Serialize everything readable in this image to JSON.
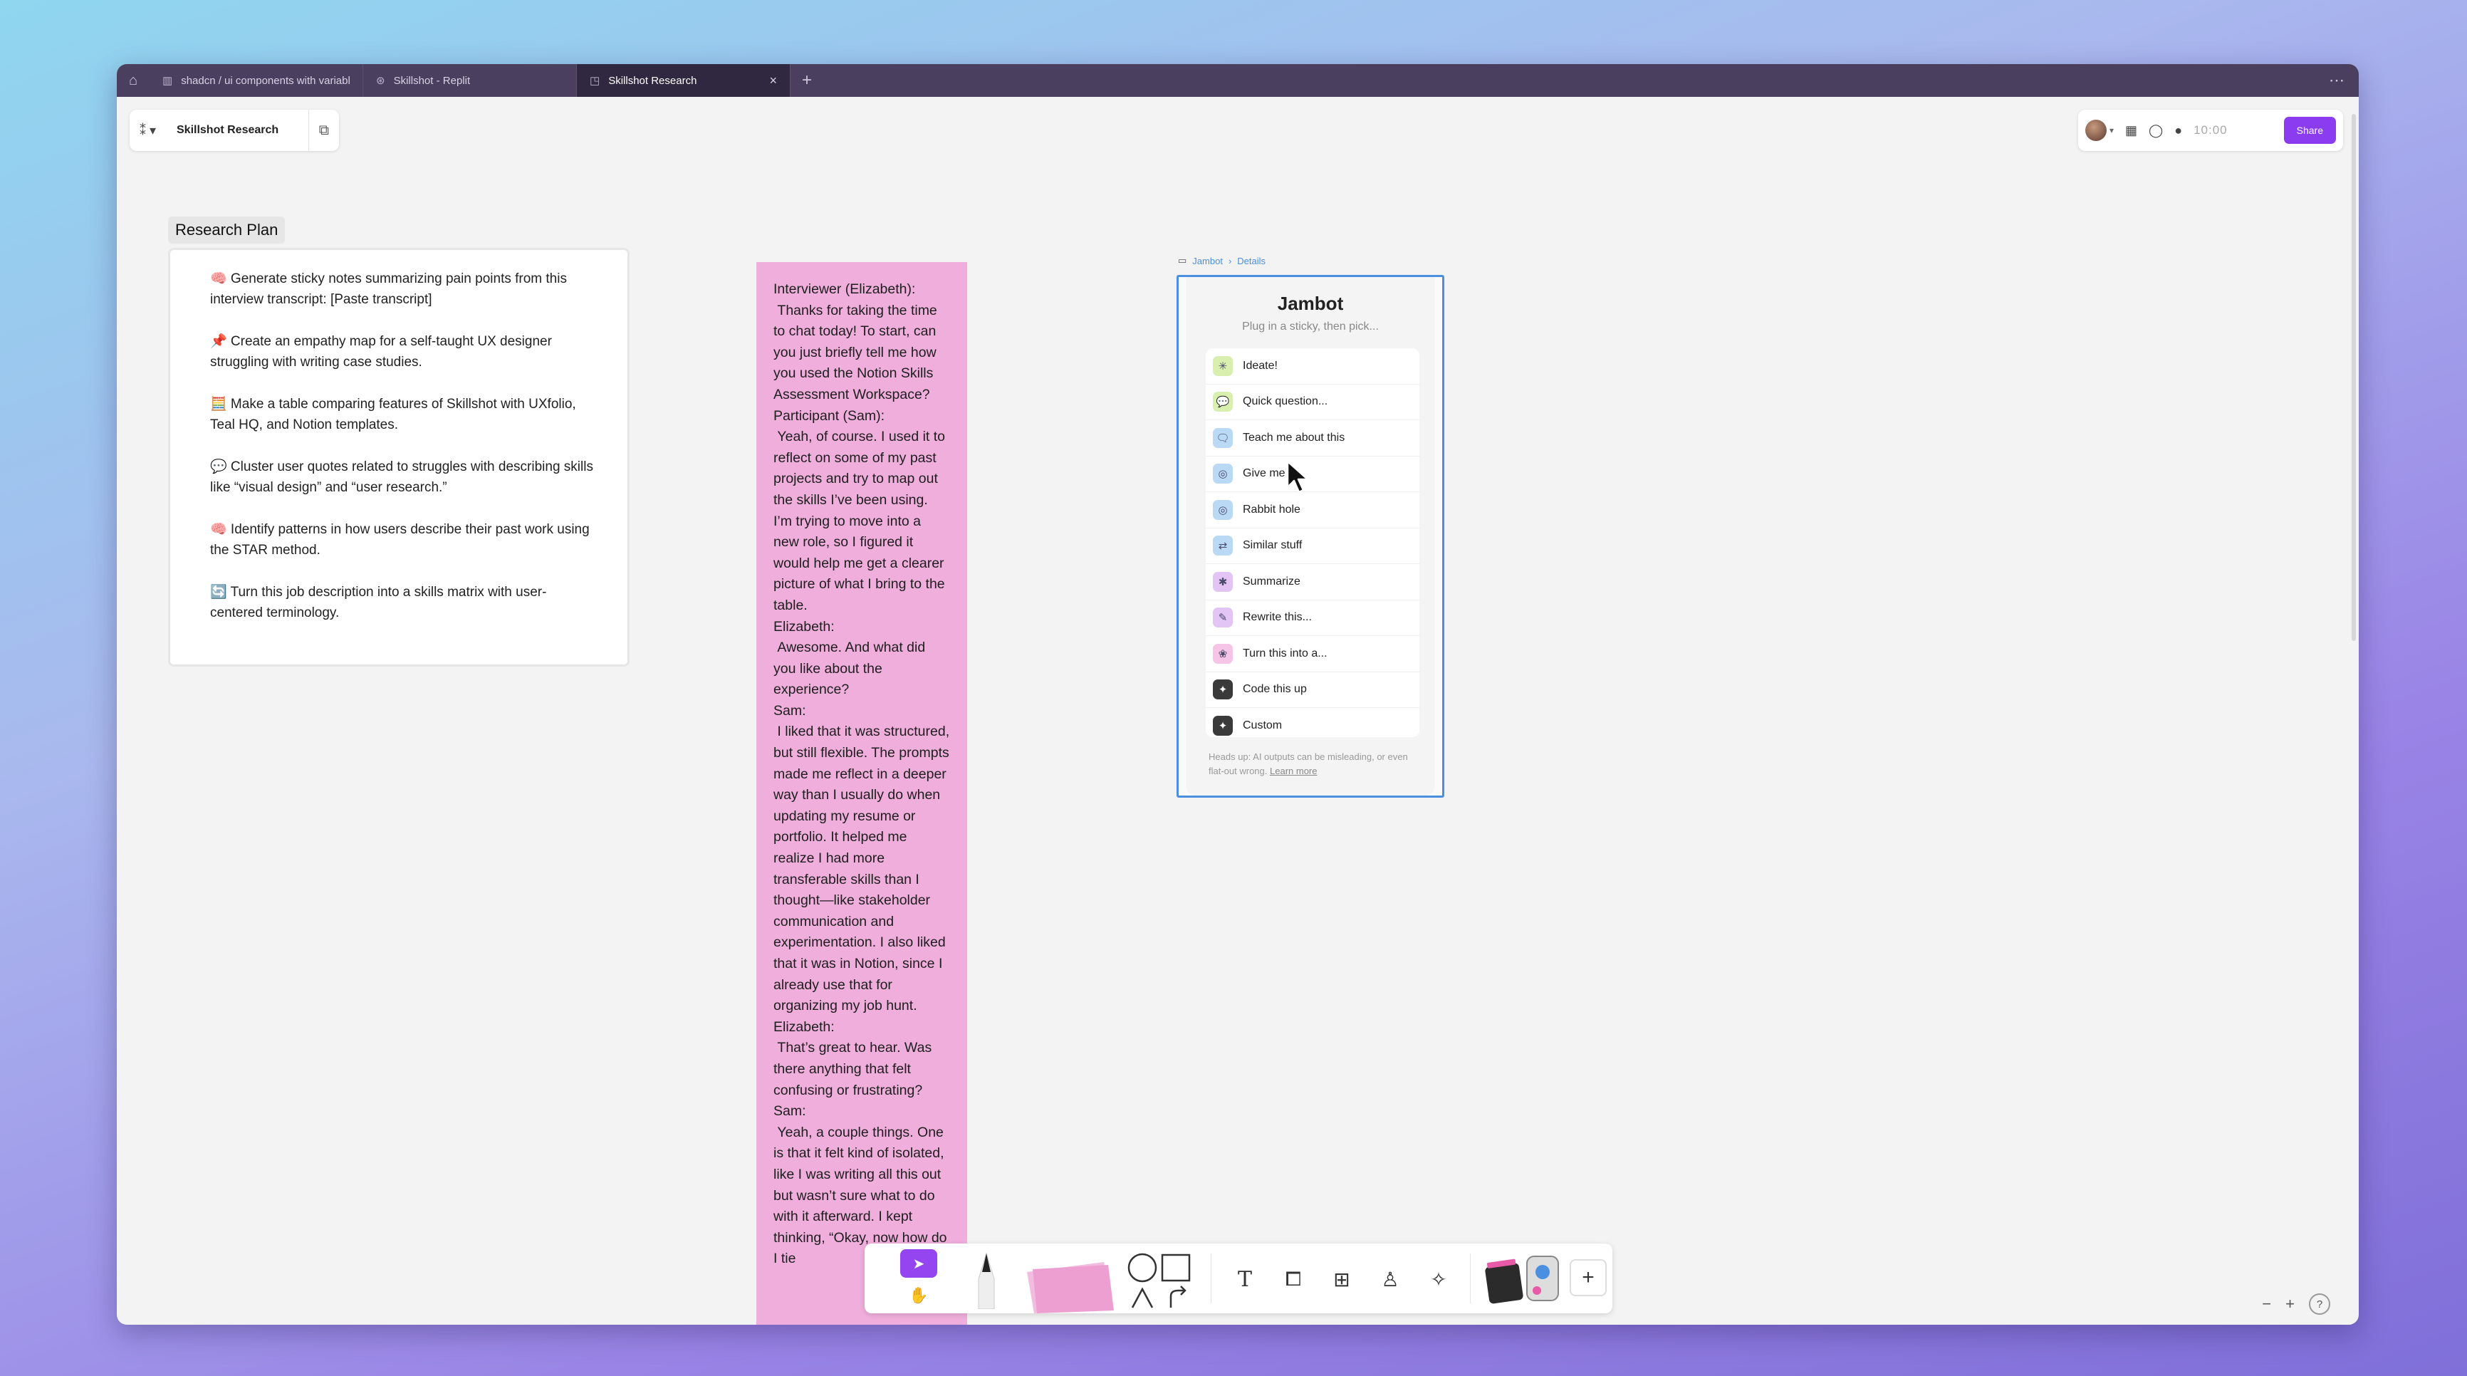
{
  "browser": {
    "tabs": [
      {
        "label": "shadcn / ui components with variable"
      },
      {
        "label": "Skillshot - Replit"
      },
      {
        "label": "Skillshot Research"
      }
    ],
    "home_icon": "home-icon",
    "new_tab": "+",
    "more": "⋯"
  },
  "board": {
    "title": "Skillshot Research",
    "timer": "10:00",
    "share_label": "Share"
  },
  "research_plan": {
    "label": "Research Plan",
    "items": [
      "🧠 Generate sticky notes summarizing pain points from this interview transcript: [Paste transcript]",
      "📌 Create an empathy map for a self-taught UX designer struggling with writing case studies.",
      "🧮 Make a table comparing features of Skillshot with UXfolio, Teal HQ, and Notion templates.",
      "💬 Cluster user quotes related to struggles with describing skills like “visual design” and “user research.”",
      "🧠 Identify patterns in how users describe their past work using the STAR method.",
      "🔄 Turn this job description into a skills matrix with user-centered terminology."
    ]
  },
  "sticky": {
    "text": "Interviewer (Elizabeth):\n Thanks for taking the time to chat today! To start, can you just briefly tell me how you used the Notion Skills Assessment Workspace?\nParticipant (Sam):\n Yeah, of course. I used it to reflect on some of my past projects and try to map out the skills I’ve been using. I’m trying to move into a new role, so I figured it would help me get a clearer picture of what I bring to the table.\nElizabeth:\n Awesome. And what did you like about the experience?\nSam:\n I liked that it was structured, but still flexible. The prompts made me reflect in a deeper way than I usually do when updating my resume or portfolio. It helped me realize I had more transferable skills than I thought—like stakeholder communication and experimentation. I also liked that it was in Notion, since I already use that for organizing my job hunt.\nElizabeth:\n That’s great to hear. Was there anything that felt confusing or frustrating?\nSam:\n Yeah, a couple things. One is that it felt kind of isolated, like I was writing all this out but wasn’t sure what to do with it afterward. I kept thinking, “Okay, now how do I tie"
  },
  "jambot": {
    "breadcrumb": [
      "Jambot",
      "Details"
    ],
    "title": "Jambot",
    "subtitle": "Plug in a sticky, then pick...",
    "options": [
      {
        "label": "Ideate!",
        "icon": "sparkle-icon",
        "color": "#d8efb0",
        "glyph": "✳"
      },
      {
        "label": "Quick question...",
        "icon": "speech-bubble-icon",
        "color": "#d8efb0",
        "glyph": "💬"
      },
      {
        "label": "Teach me about this",
        "icon": "chat-bubbles-icon",
        "color": "#b9d9f5",
        "glyph": "🗨"
      },
      {
        "label": "Give me",
        "icon": "target-icon",
        "color": "#b9d9f5",
        "glyph": "◎"
      },
      {
        "label": "Rabbit hole",
        "icon": "spiral-icon",
        "color": "#b9d9f5",
        "glyph": "◎"
      },
      {
        "label": "Similar stuff",
        "icon": "link-icon",
        "color": "#b9d9f5",
        "glyph": "⇄"
      },
      {
        "label": "Summarize",
        "icon": "asterisk-icon",
        "color": "#e2c4f5",
        "glyph": "✱"
      },
      {
        "label": "Rewrite this...",
        "icon": "pen-icon",
        "color": "#e2c4f5",
        "glyph": "✎"
      },
      {
        "label": "Turn this into a...",
        "icon": "transform-icon",
        "color": "#f5c4e6",
        "glyph": "❀"
      },
      {
        "label": "Code this up",
        "icon": "code-icon",
        "color": "#3a3a3a",
        "glyph": "✦"
      },
      {
        "label": "Custom",
        "icon": "custom-icon",
        "color": "#3a3a3a",
        "glyph": "✦"
      }
    ],
    "footer": "Heads up: AI outputs can be misleading, or even flat-out wrong.",
    "learn_more": "Learn more"
  },
  "toolbar": {
    "select": "select-tool",
    "hand": "hand-tool",
    "text_tool": "T",
    "add": "+"
  },
  "zoom": {
    "out": "−",
    "in": "+",
    "help": "?"
  },
  "colors": {
    "accent": "#8c3cf0",
    "sticky": "#efaedb",
    "selection": "#4a8fe0",
    "tabbar": "#4a3f5f"
  }
}
